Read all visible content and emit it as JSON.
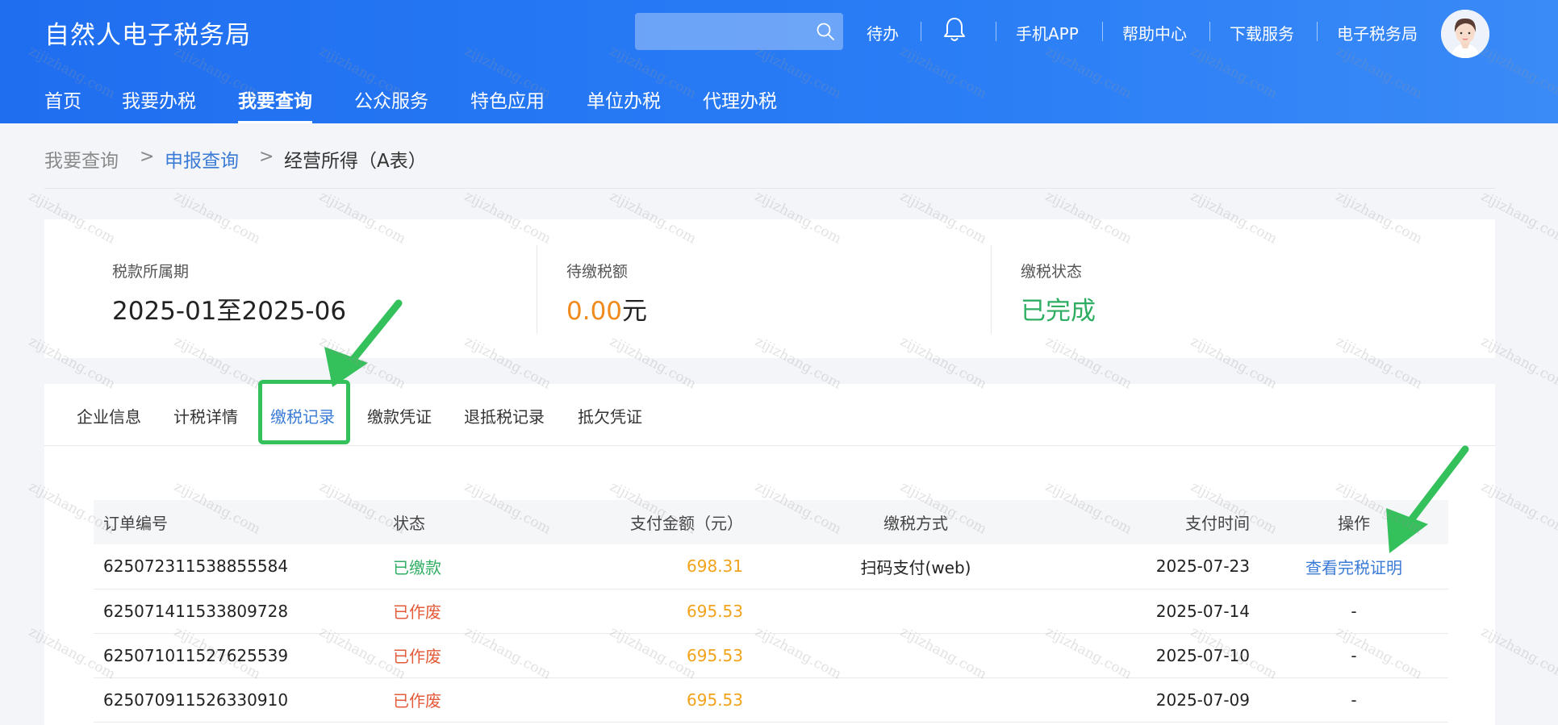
{
  "header": {
    "brand": "自然人电子税务局",
    "search_placeholder": "",
    "links": {
      "todo": "待办",
      "mobile_app": "手机APP",
      "help": "帮助中心",
      "download": "下载服务",
      "etax": "电子税务局"
    },
    "nav": [
      {
        "label": "首页"
      },
      {
        "label": "我要办税"
      },
      {
        "label": "我要查询",
        "active": true
      },
      {
        "label": "公众服务"
      },
      {
        "label": "特色应用"
      },
      {
        "label": "单位办税"
      },
      {
        "label": "代理办税"
      }
    ]
  },
  "breadcrumb": {
    "level1": "我要查询",
    "level2": "申报查询",
    "current": "经营所得（A表）",
    "separator": ">"
  },
  "summary": {
    "period_label": "税款所属期",
    "period_value": "2025-01至2025-06",
    "pending_label": "待缴税额",
    "pending_amount": "0.00",
    "pending_unit": "元",
    "status_label": "缴税状态",
    "status_value": "已完成"
  },
  "tabs": [
    {
      "label": "企业信息"
    },
    {
      "label": "计税详情"
    },
    {
      "label": "缴税记录",
      "active": true
    },
    {
      "label": "缴款凭证"
    },
    {
      "label": "退抵税记录"
    },
    {
      "label": "抵欠凭证"
    }
  ],
  "table": {
    "headers": [
      "订单编号",
      "状态",
      "支付金额（元）",
      "缴税方式",
      "支付时间",
      "操作"
    ],
    "rows": [
      {
        "id": "625072311538855584",
        "status": "已缴款",
        "amount": "698.31",
        "method": "扫码支付(web)",
        "time": "2025-07-23",
        "op": "查看完税证明"
      },
      {
        "id": "625071411533809728",
        "status": "已作废",
        "amount": "695.53",
        "method": "",
        "time": "2025-07-14",
        "op": "-"
      },
      {
        "id": "625071011527625539",
        "status": "已作废",
        "amount": "695.53",
        "method": "",
        "time": "2025-07-10",
        "op": "-"
      },
      {
        "id": "625070911526330910",
        "status": "已作废",
        "amount": "695.53",
        "method": "",
        "time": "2025-07-09",
        "op": "-"
      }
    ]
  },
  "watermark": "zijizhang.com",
  "colors": {
    "header_blue": "#2a7df5",
    "link_blue": "#3a7bd5",
    "success_green": "#2fae63",
    "void_red": "#e45b3a",
    "amount_orange": "#f2a31b",
    "pending_orange": "#f08a1c",
    "annotation_green": "#34c05a"
  }
}
